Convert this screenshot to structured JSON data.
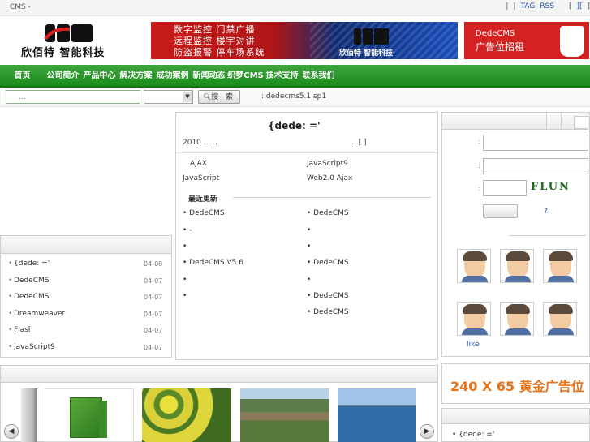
{
  "topbar": {
    "title": "CMS -",
    "sep1": "|",
    "sep2": "|",
    "tag": "TAG",
    "rss": "RSS",
    "bracket1": "[",
    "bracket2": "][",
    "bracket3": "]"
  },
  "logo": {
    "text": "欣佰特 智能科技"
  },
  "banner": {
    "line1": "数字监控  门禁广播",
    "line2": "远程监控  楼宇对讲",
    "line3": "防盗报警  停车场系统",
    "brand": "欣佰特 智能科技"
  },
  "ad": {
    "line1": "DedeCMS",
    "line2": "广告位招租"
  },
  "nav": {
    "items": [
      "首页",
      "公司简介",
      "产品中心",
      "解决方案",
      "成功案例",
      "新闻动态",
      "织梦CMS",
      "技术支持",
      "联系我们"
    ]
  },
  "search": {
    "placeholder": "...",
    "button": "搜 索",
    "version": ": dedecms5.1 sp1"
  },
  "left_list": [
    {
      "title": "{dede:      ='",
      "date": "04-08"
    },
    {
      "title": "DedeCMS",
      "date": "04-07"
    },
    {
      "title": "DedeCMS",
      "date": "04-07"
    },
    {
      "title": "Dreamweaver",
      "date": "04-07"
    },
    {
      "title": "  Flash",
      "date": "04-07"
    },
    {
      "title": "JavaScript9",
      "date": "04-07"
    }
  ],
  "mid": {
    "headline": "{dede:         ='",
    "summary": "2010      ......",
    "more": "...[  ]",
    "cells": [
      {
        "text": "AJAX"
      },
      {
        "text": "JavaScript9"
      },
      {
        "text": "JavaScript"
      },
      {
        "text": "Web2.0  Ajax"
      }
    ],
    "latest_title": "最近更新",
    "latest_left": [
      "• DedeCMS",
      "•      -",
      "•",
      "• DedeCMS V5.6",
      "•",
      "•"
    ],
    "latest_right": [
      "• DedeCMS",
      "•",
      "•",
      "• DedeCMS",
      "•",
      "• DedeCMS",
      "• DedeCMS"
    ]
  },
  "login": {
    "star": ":",
    "captcha": "FLUN",
    "question": "?",
    "like": "like"
  },
  "ad2": {
    "text": "240 X 65 黄金广告位"
  },
  "right2": {
    "item": "• {dede:      ='"
  },
  "carousel": {
    "prev": "◀",
    "next": "▶"
  }
}
